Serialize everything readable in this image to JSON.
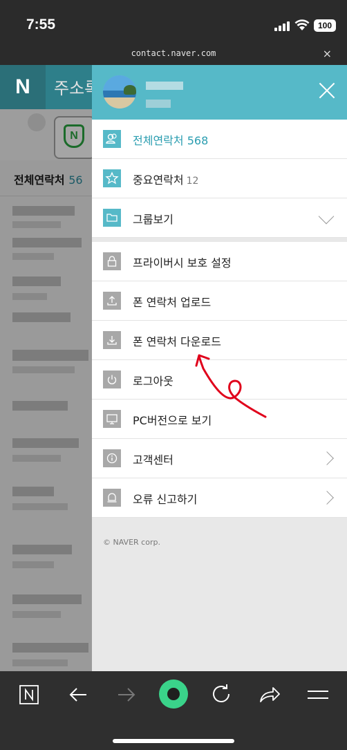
{
  "status": {
    "time": "7:55",
    "battery": "100"
  },
  "urlbar": {
    "url": "contact.naver.com",
    "close": "×"
  },
  "background": {
    "logo": "N",
    "title": "주소록",
    "promo_badge": "N",
    "list_header": "전체연락처",
    "list_count": "56"
  },
  "drawer": {
    "menu": [
      {
        "label": "전체연락처",
        "count": "568",
        "icon": "contacts-icon",
        "active": true
      },
      {
        "label": "중요연락처",
        "count": "12",
        "icon": "star-icon"
      },
      {
        "label": "그룹보기",
        "icon": "folder-icon"
      }
    ],
    "settings": [
      {
        "label": "프라이버시 보호 설정",
        "icon": "lock-icon"
      },
      {
        "label": "폰 연락처 업로드",
        "icon": "upload-icon"
      },
      {
        "label": "폰 연락처 다운로드",
        "icon": "download-icon"
      },
      {
        "label": "로그아웃",
        "icon": "power-icon"
      },
      {
        "label": "PC버전으로 보기",
        "icon": "monitor-icon"
      },
      {
        "label": "고객센터",
        "icon": "info-icon"
      },
      {
        "label": "오류 신고하기",
        "icon": "bell-icon"
      }
    ],
    "copyright": "© NAVER corp."
  },
  "colors": {
    "accent": "#56b9c8",
    "annotation": "#e0001b",
    "nav_green": "#3ad38a"
  }
}
